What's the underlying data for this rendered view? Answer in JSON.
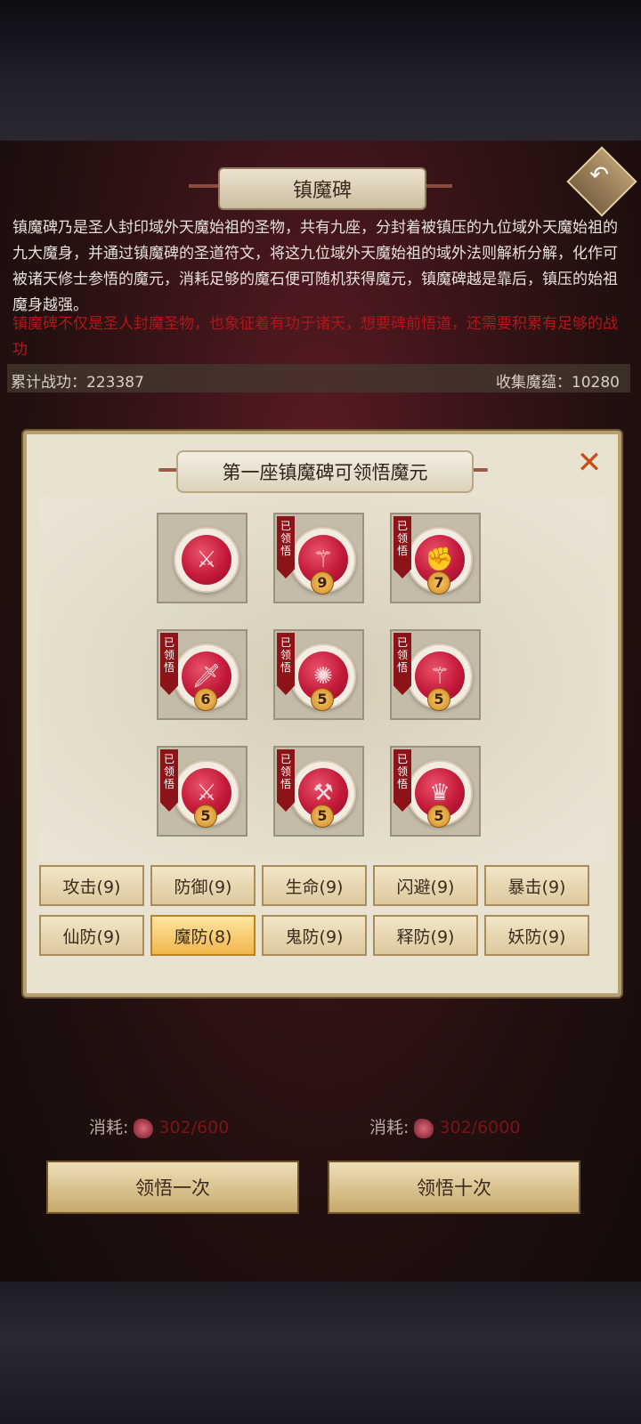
{
  "header": {
    "title": "镇魔碑"
  },
  "description": {
    "main": "镇魔碑乃是圣人封印域外天魔始祖的圣物，共有九座，分封着被镇压的九位域外天魔始祖的九大魔身，并通过镇魔碑的圣道符文，将这九位域外天魔始祖的域外法则解析分解，化作可被诸天修士参悟的魔元，消耗足够的魔石便可随机获得魔元，镇魔碑越是靠后，镇压的始祖魔身越强。",
    "warning": "镇魔碑不仅是圣人封魔圣物，也象征着有功于诸天，想要碑前悟道，还需要积累有足够的战功"
  },
  "stats": {
    "merit": "累计战功：223387",
    "collected": "收集魔蕴：10280"
  },
  "panel": {
    "title": "第一座镇魔碑可领悟魔元",
    "close_icon": "close-icon",
    "slots": [
      {
        "icon": "claw-icon",
        "glyph": "⚔",
        "learned": false,
        "tag": "",
        "level": ""
      },
      {
        "icon": "sword-icon",
        "glyph": "⚚",
        "learned": true,
        "tag": "已领悟",
        "level": "9"
      },
      {
        "icon": "fist-icon",
        "glyph": "✊",
        "learned": true,
        "tag": "已领悟",
        "level": "7"
      },
      {
        "icon": "dagger-icon",
        "glyph": "🗡",
        "learned": true,
        "tag": "已领悟",
        "level": "6"
      },
      {
        "icon": "swirl-icon",
        "glyph": "✺",
        "learned": true,
        "tag": "已领悟",
        "level": "5"
      },
      {
        "icon": "trident-icon",
        "glyph": "⚚",
        "learned": true,
        "tag": "已领悟",
        "level": "5"
      },
      {
        "icon": "spear-icon",
        "glyph": "⚔",
        "learned": true,
        "tag": "已领悟",
        "level": "5"
      },
      {
        "icon": "blade-icon",
        "glyph": "⚒",
        "learned": true,
        "tag": "已领悟",
        "level": "5"
      },
      {
        "icon": "crown-icon",
        "glyph": "♛",
        "learned": true,
        "tag": "已领悟",
        "level": "5"
      }
    ],
    "categories": [
      {
        "label": "攻击(9)",
        "active": false
      },
      {
        "label": "防御(9)",
        "active": false
      },
      {
        "label": "生命(9)",
        "active": false
      },
      {
        "label": "闪避(9)",
        "active": false
      },
      {
        "label": "暴击(9)",
        "active": false
      },
      {
        "label": "仙防(9)",
        "active": false
      },
      {
        "label": "魔防(8)",
        "active": true
      },
      {
        "label": "鬼防(9)",
        "active": false
      },
      {
        "label": "释防(9)",
        "active": false
      },
      {
        "label": "妖防(9)",
        "active": false
      }
    ]
  },
  "actions": {
    "once": {
      "cost_label": "消耗:",
      "cost_value": "302/600",
      "button": "领悟一次"
    },
    "ten": {
      "cost_label": "消耗:",
      "cost_value": "302/6000",
      "button": "领悟十次"
    }
  },
  "colors": {
    "accent_red": "#b0171c",
    "panel_bg": "#e9e2d0",
    "active_tab": "#f1b64c"
  }
}
